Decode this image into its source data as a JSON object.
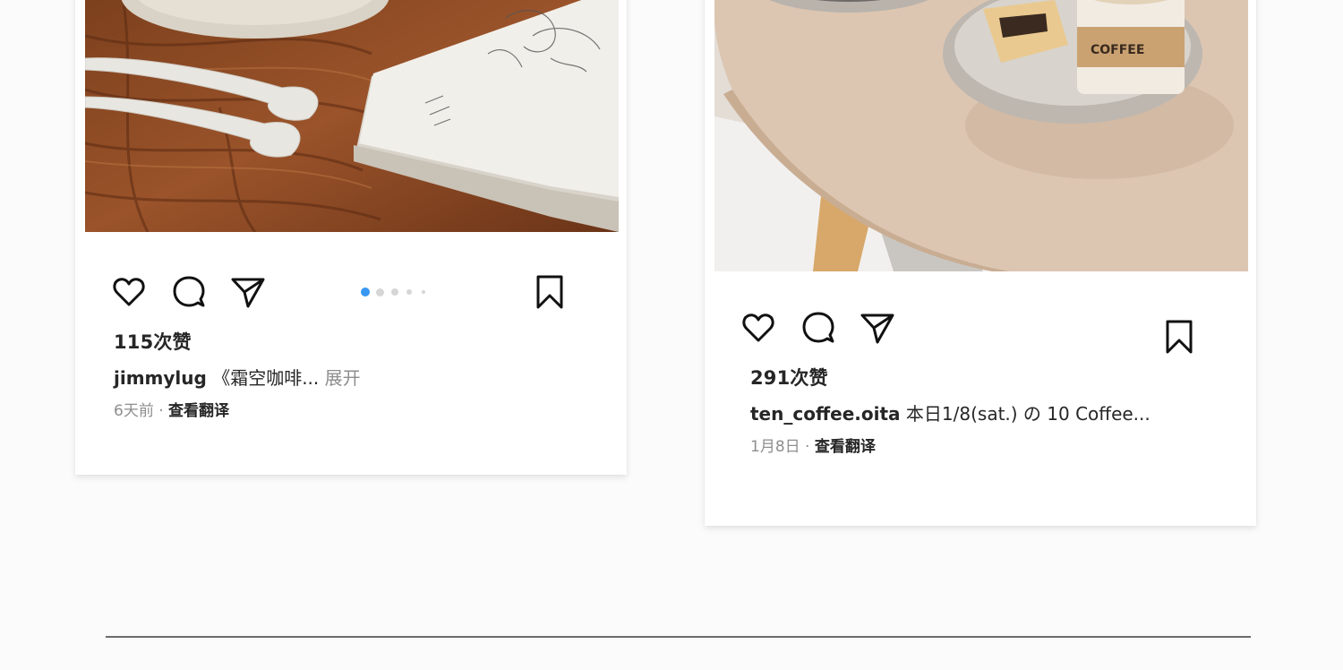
{
  "posts": [
    {
      "likes": "115次赞",
      "username": "jimmylug",
      "caption": "《霜空咖啡...",
      "expand": "展开",
      "time": "6天前",
      "separator": "·",
      "translate": "查看翻译",
      "carousel": {
        "count": 5,
        "active": 0
      },
      "icons": [
        "heart-icon",
        "comment-icon",
        "send-icon",
        "bookmark-icon"
      ]
    },
    {
      "likes": "291次赞",
      "username": "ten_coffee.oita",
      "caption": "本日1/8(sat.) の 10 Coffee...",
      "time": "1月8日",
      "separator": "·",
      "translate": "查看翻译",
      "icons": [
        "heart-icon",
        "comment-icon",
        "send-icon",
        "bookmark-icon"
      ]
    }
  ],
  "colors": {
    "accent": "#3897f0",
    "text": "#262626",
    "muted": "#8e8e8e",
    "divider": "#6b6b6b"
  }
}
